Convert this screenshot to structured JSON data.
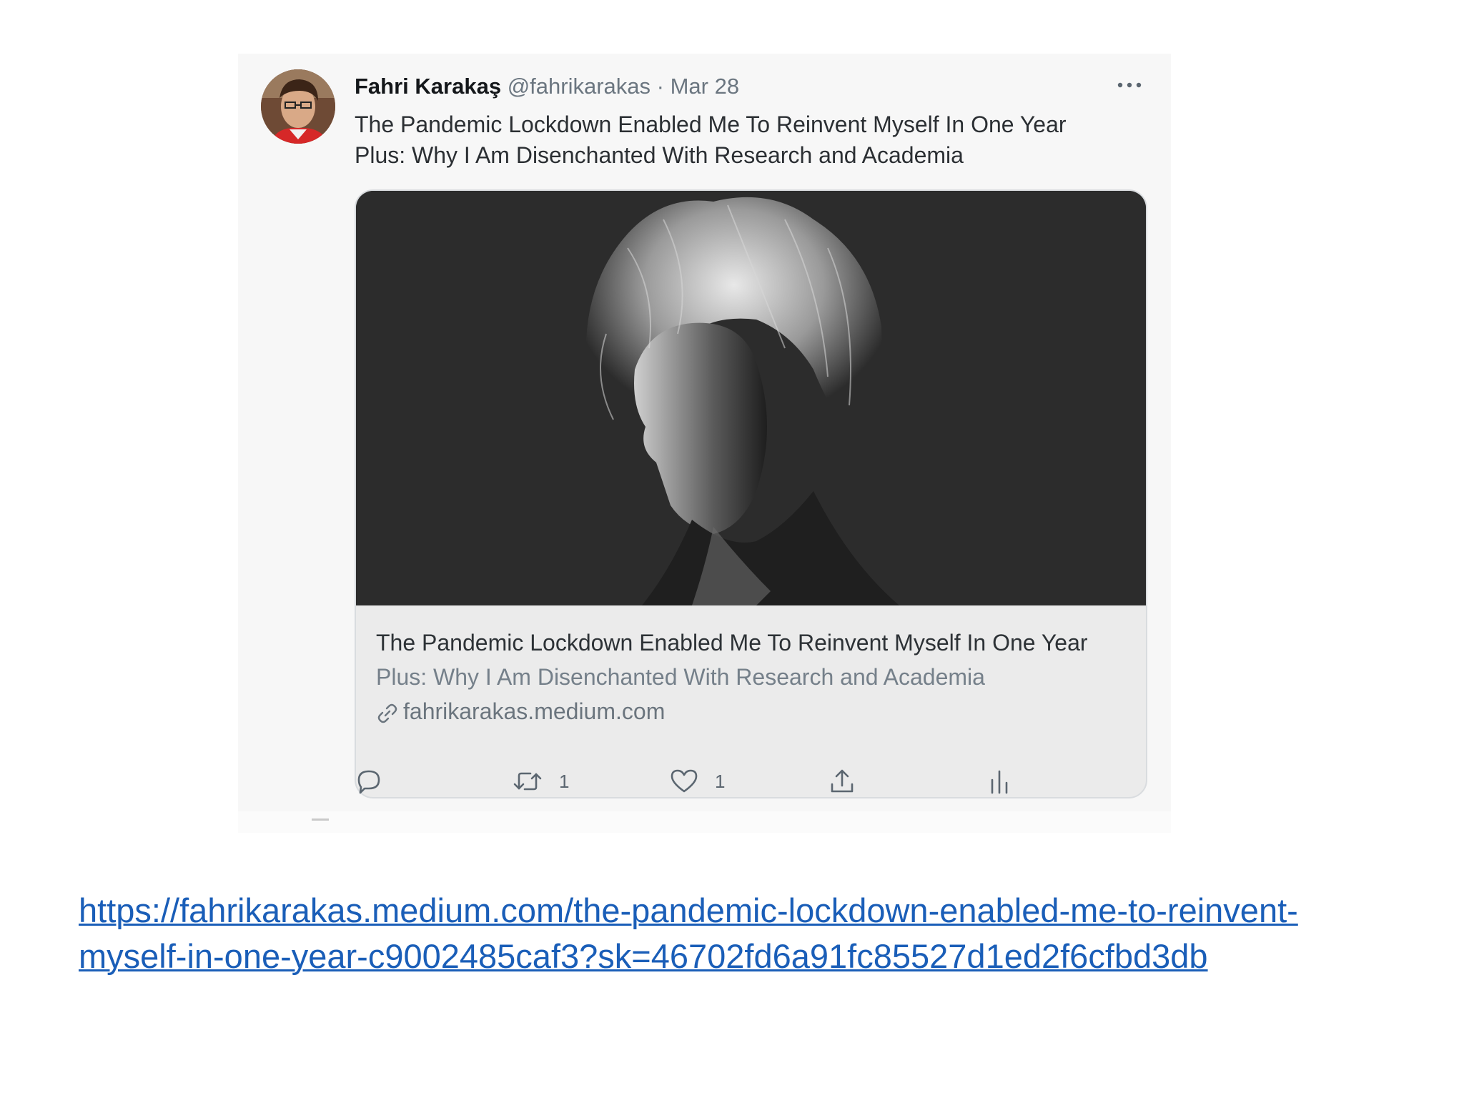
{
  "tweet": {
    "author_name": "Fahri Karakaş",
    "author_handle": "@fahrikarakas",
    "separator": "·",
    "date": "Mar 28",
    "more_icon": "more-horizontal-icon",
    "text_line1": "The Pandemic Lockdown Enabled Me To Reinvent Myself In One Year",
    "text_line2": "Plus: Why I Am Disenchanted With Research and Academia",
    "card": {
      "title": "The Pandemic Lockdown Enabled Me To Reinvent Myself In One Year",
      "description": "Plus: Why I Am Disenchanted With Research and Academia",
      "domain": "fahrikarakas.medium.com",
      "domain_icon": "link-icon"
    },
    "actions": {
      "reply_icon": "reply-icon",
      "retweet_icon": "retweet-icon",
      "retweet_count": "1",
      "like_icon": "heart-icon",
      "like_count": "1",
      "share_icon": "share-icon",
      "analytics_icon": "analytics-icon"
    }
  },
  "link": {
    "line1": "https://fahrikarakas.medium.com/the-pandemic-lockdown-enabled-me-to-reinvent-",
    "line2": "myself-in-one-year-c9002485caf3?sk=46702fd6a91fc85527d1ed2f6cfbd3db"
  },
  "colors": {
    "link": "#1a5eb8",
    "tweet_background": "#f7f7f7",
    "card_background": "#ebebeb",
    "muted_text": "#6b7680"
  }
}
